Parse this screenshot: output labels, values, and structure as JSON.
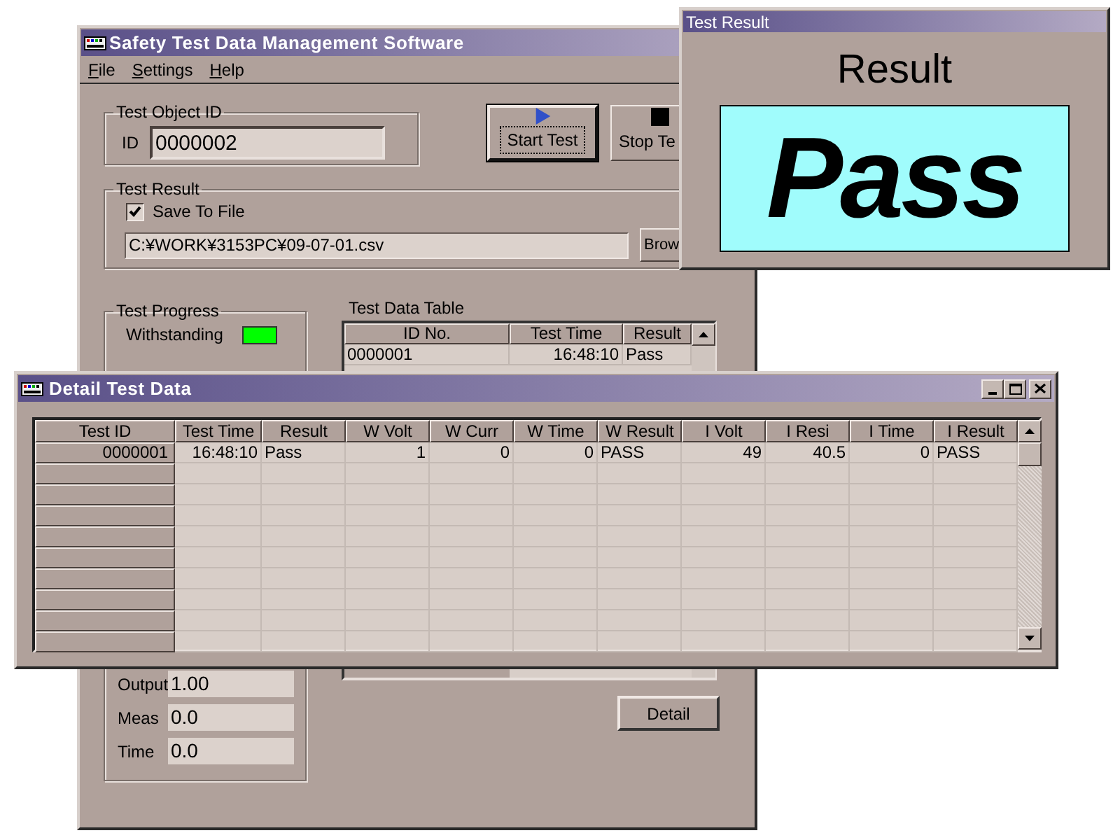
{
  "main_window": {
    "title": "Safety Test Data Management Software",
    "menu": [
      "File",
      "Settings",
      "Help"
    ],
    "test_object_id": {
      "legend": "Test Object ID",
      "label": "ID",
      "value": "0000002"
    },
    "buttons": [
      {
        "kind": "start",
        "label": "Start Test",
        "focused": true
      },
      {
        "kind": "stop",
        "label": "Stop Te",
        "focused": false
      }
    ],
    "test_result": {
      "legend": "Test Result",
      "save_to_file": {
        "label": "Save To File",
        "checked": true
      },
      "path": "C:¥WORK¥3153PC¥09-07-01.csv",
      "browse_button": "Brow"
    },
    "test_progress": {
      "legend": "Test Progress",
      "stages": [
        {
          "label": "Withstanding",
          "color": "#00ff00"
        }
      ],
      "readings": [
        {
          "label": "Output",
          "value": "1.00"
        },
        {
          "label": "Meas",
          "value": "0.0"
        },
        {
          "label": "Time",
          "value": "0.0"
        }
      ]
    },
    "test_data_table": {
      "title": "Test Data Table",
      "columns": [
        "ID No.",
        "Test Time",
        "Result"
      ],
      "rows": [
        [
          "0000001",
          "16:48:10",
          "Pass"
        ]
      ]
    },
    "detail_button": "Detail"
  },
  "detail_window": {
    "title": "Detail Test Data",
    "columns": [
      "Test ID",
      "Test Time",
      "Result",
      "W Volt",
      "W Curr",
      "W Time",
      "W Result",
      "I Volt",
      "I Resi",
      "I Time",
      "I Result"
    ],
    "rows": [
      [
        "0000001",
        "16:48:10",
        "Pass",
        "1",
        "0",
        "0",
        "PASS",
        "49",
        "40.5",
        "0",
        "PASS"
      ]
    ]
  },
  "result_window": {
    "title": "Test Result",
    "heading": "Result",
    "verdict": "Pass"
  }
}
